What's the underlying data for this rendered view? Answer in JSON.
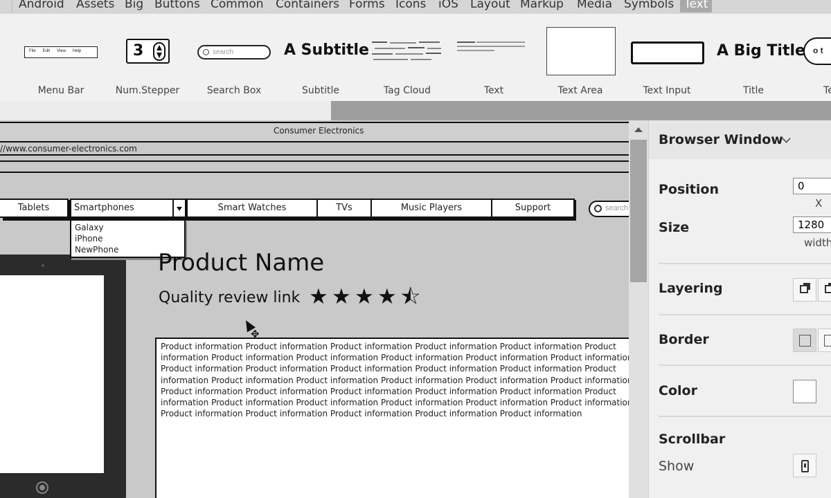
{
  "categories": [
    "Android",
    "Assets",
    "Big",
    "Buttons",
    "Common",
    "Containers",
    "Forms",
    "Icons",
    "iOS",
    "Layout",
    "Markup",
    "Media",
    "Symbols",
    "Text"
  ],
  "active_category": "Text",
  "library": {
    "items": [
      "Menu Bar",
      "Num.Stepper",
      "Search Box",
      "Subtitle",
      "Tag Cloud",
      "Text",
      "Text Area",
      "Text Input",
      "Title",
      "Te"
    ],
    "menubar_items": [
      "File",
      "Edit",
      "View",
      "Help"
    ],
    "stepper_value": "3",
    "search_placeholder": "search",
    "subtitle_sample": "A Subtitle",
    "title_sample": "A Big Title",
    "bubble_sample": "o t"
  },
  "canvas": {
    "window_title": "Consumer Electronics",
    "url": "//www.consumer-electronics.com",
    "nav": [
      "Tablets",
      "Smartphones",
      "Smart Watches",
      "TVs",
      "Music Players",
      "Support"
    ],
    "dropdown_options": [
      "Galaxy",
      "iPhone",
      "NewPhone"
    ],
    "search_placeholder": "search",
    "product_name": "Product Name",
    "review_link": "Quality review link",
    "rating": 4.5,
    "rating_max": 5,
    "product_info": "Product information Product information Product information Product information Product information Product information Product information Product information Product information Product information Product information Product information Product information Product information Product information Product information Product information Product information Product information Product information Product information Product information Product information Product information Product information Product information Product information Product information Product information Product information Product information Product information Product information Product information Product information Product information Product information Product information"
  },
  "panel": {
    "title": "Browser Window",
    "position": {
      "label": "Position",
      "x_value": "0",
      "x_hint": "X"
    },
    "size": {
      "label": "Size",
      "width_value": "1280",
      "width_hint": "width"
    },
    "layering_label": "Layering",
    "border_label": "Border",
    "color_label": "Color",
    "color_value": "#ffffff",
    "scrollbar": {
      "label": "Scrollbar",
      "show_label": "Show"
    }
  }
}
